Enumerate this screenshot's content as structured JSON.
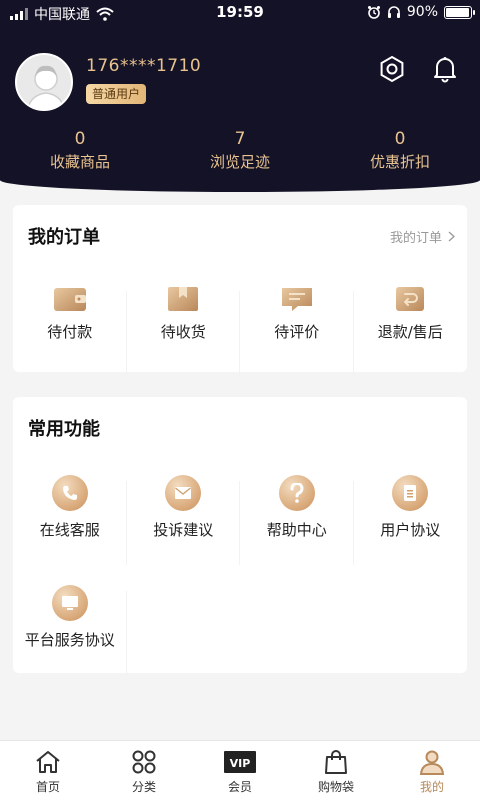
{
  "status_bar": {
    "carrier": "中国联通",
    "time": "19:59",
    "battery": "90%"
  },
  "profile": {
    "phone": "176****1710",
    "member_badge": "普通用户"
  },
  "stats": [
    {
      "value": "0",
      "label": "收藏商品"
    },
    {
      "value": "7",
      "label": "浏览足迹"
    },
    {
      "value": "0",
      "label": "优惠折扣"
    }
  ],
  "orders": {
    "title": "我的订单",
    "more_label": "我的订单",
    "items": [
      {
        "label": "待付款",
        "icon": "wallet-icon"
      },
      {
        "label": "待收货",
        "icon": "package-icon"
      },
      {
        "label": "待评价",
        "icon": "comment-icon"
      },
      {
        "label": "退款/售后",
        "icon": "refund-icon"
      }
    ]
  },
  "functions": {
    "title": "常用功能",
    "items": [
      {
        "label": "在线客服",
        "icon": "phone-icon"
      },
      {
        "label": "投诉建议",
        "icon": "mail-icon"
      },
      {
        "label": "帮助中心",
        "icon": "question-icon"
      },
      {
        "label": "用户协议",
        "icon": "document-icon"
      },
      {
        "label": "平台服务协议",
        "icon": "monitor-icon"
      }
    ]
  },
  "tabbar": {
    "items": [
      {
        "label": "首页",
        "icon": "home-icon",
        "active": false
      },
      {
        "label": "分类",
        "icon": "category-icon",
        "active": false
      },
      {
        "label": "会员",
        "icon": "vip-icon",
        "active": false
      },
      {
        "label": "购物袋",
        "icon": "shopping-bag-icon",
        "active": false
      },
      {
        "label": "我的",
        "icon": "user-icon",
        "active": true
      }
    ],
    "vip_text": "VIP"
  },
  "colors": {
    "header_bg": "#141226",
    "accent_gold": "#e8c28f",
    "active_tab": "#b8895a"
  }
}
